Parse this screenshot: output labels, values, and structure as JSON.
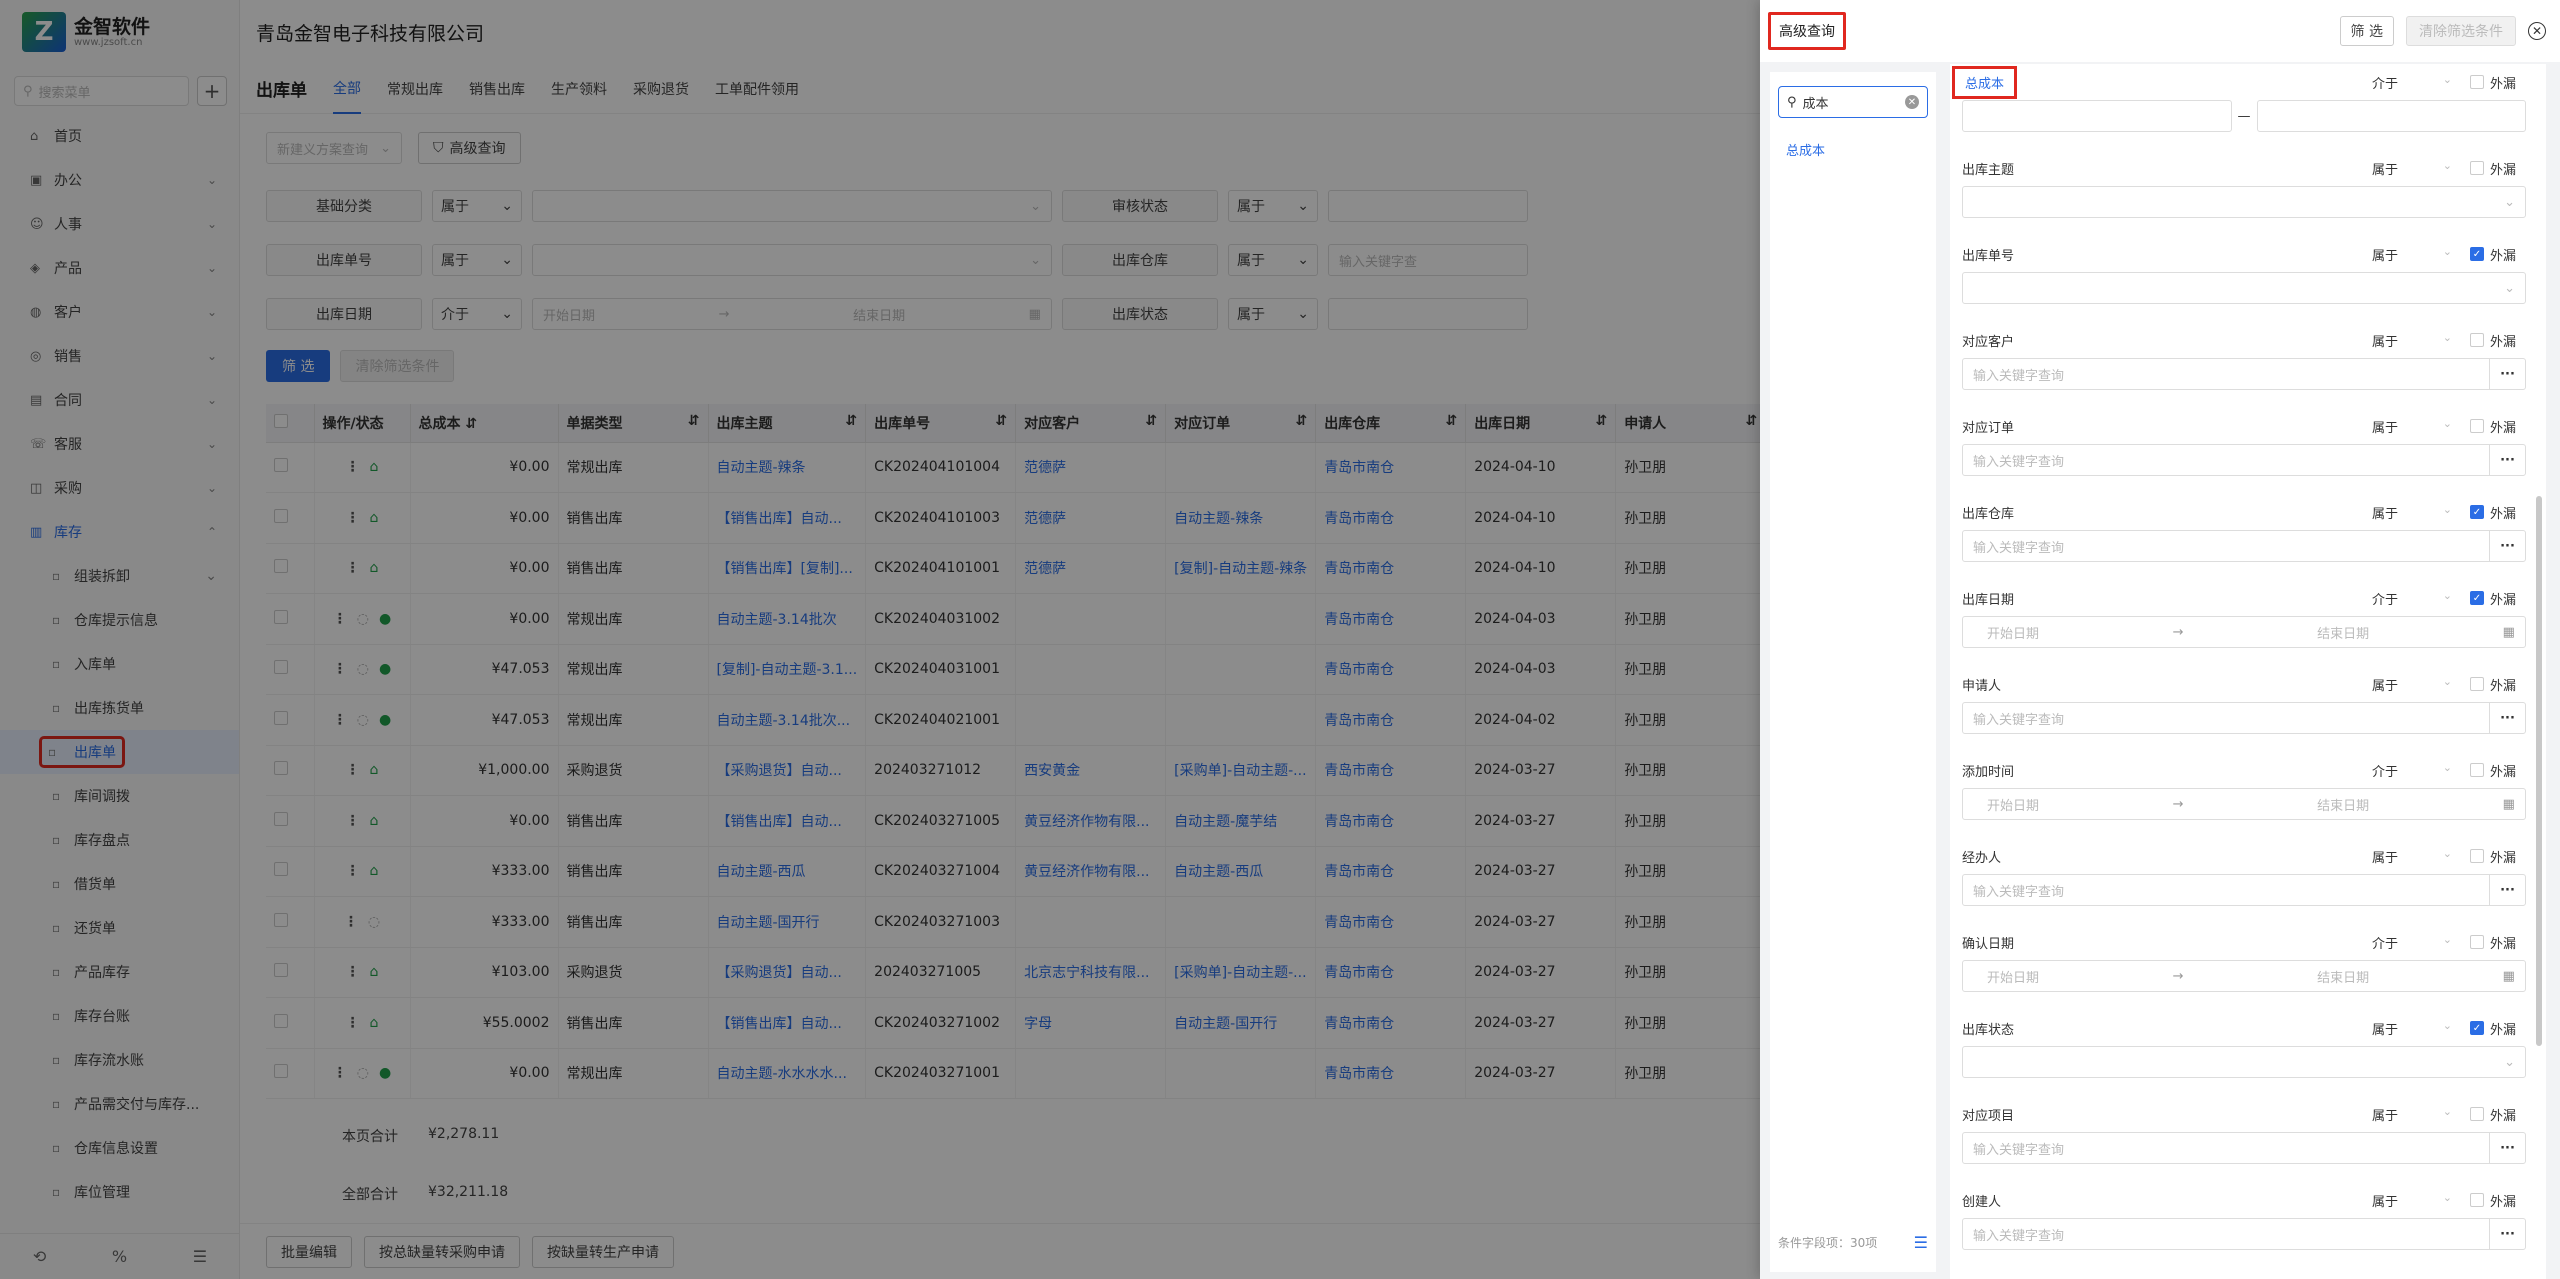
{
  "brand": {
    "name": "金智软件",
    "url": "www.jzsoft.cn"
  },
  "company": "青岛金智电子科技有限公司",
  "sidebar": {
    "search_placeholder": "搜索菜单",
    "items": [
      {
        "icon": "home-icon",
        "label": "首页"
      },
      {
        "icon": "office-icon",
        "label": "办公"
      },
      {
        "icon": "people-icon",
        "label": "人事"
      },
      {
        "icon": "product-icon",
        "label": "产品"
      },
      {
        "icon": "customer-icon",
        "label": "客户"
      },
      {
        "icon": "sales-icon",
        "label": "销售"
      },
      {
        "icon": "contract-icon",
        "label": "合同"
      },
      {
        "icon": "service-icon",
        "label": "客服"
      },
      {
        "icon": "purchase-icon",
        "label": "采购"
      },
      {
        "icon": "warehouse-icon",
        "label": "库存"
      }
    ],
    "sub_items": [
      "组装拆卸",
      "仓库提示信息",
      "入库单",
      "出库拣货单",
      "出库单",
      "库间调拨",
      "库存盘点",
      "借货单",
      "还货单",
      "产品库存",
      "库存台账",
      "库存流水账",
      "产品需交付与库存...",
      "仓库信息设置",
      "库位管理"
    ]
  },
  "page": {
    "title": "出库单",
    "tabs": [
      "全部",
      "常规出库",
      "销售出库",
      "生产领料",
      "采购退货",
      "工单配件领用"
    ],
    "custom_query_placeholder": "新建义方案查询",
    "advanced_query": "高级查询",
    "filters": [
      {
        "label": "基础分类",
        "op": "属于",
        "val": ""
      },
      {
        "label": "审核状态",
        "op": "属于",
        "val": ""
      },
      {
        "label": "出库单号",
        "op": "属于",
        "val": ""
      },
      {
        "label": "出库仓库",
        "op": "属于",
        "val": "输入关键字查"
      },
      {
        "label": "出库日期",
        "op": "介于",
        "start": "开始日期",
        "end": "结束日期"
      },
      {
        "label": "出库状态",
        "op": "属于",
        "val": ""
      }
    ],
    "filter_btn": "筛 选",
    "clear_btn": "清除筛选条件"
  },
  "table": {
    "headers": [
      "操作/状态",
      "总成本",
      "单据类型",
      "出库主题",
      "出库单号",
      "对应客户",
      "对应订单",
      "出库仓库",
      "出库日期",
      "申请人"
    ],
    "rows": [
      {
        "icons": "g",
        "cost": "¥0.00",
        "type": "常规出库",
        "subject": "自动主题-辣条",
        "no": "CK202404101004",
        "customer": "范德萨",
        "order": "",
        "wh": "青岛市南仓",
        "date": "2024-04-10",
        "applicant": "孙卫朋"
      },
      {
        "icons": "g",
        "cost": "¥0.00",
        "type": "销售出库",
        "subject": "【销售出库】自动...",
        "no": "CK202404101003",
        "customer": "范德萨",
        "order": "自动主题-辣条",
        "wh": "青岛市南仓",
        "date": "2024-04-10",
        "applicant": "孙卫朋"
      },
      {
        "icons": "g",
        "cost": "¥0.00",
        "type": "销售出库",
        "subject": "【销售出库】[复制]...",
        "no": "CK202404101001",
        "customer": "范德萨",
        "order": "[复制]-自动主题-辣条",
        "wh": "青岛市南仓",
        "date": "2024-04-10",
        "applicant": "孙卫朋"
      },
      {
        "icons": "rg",
        "cost": "¥0.00",
        "type": "常规出库",
        "subject": "自动主题-3.14批次",
        "no": "CK202404031002",
        "customer": "",
        "order": "",
        "wh": "青岛市南仓",
        "date": "2024-04-03",
        "applicant": "孙卫朋"
      },
      {
        "icons": "rg",
        "cost": "¥47.053",
        "type": "常规出库",
        "subject": "[复制]-自动主题-3.1...",
        "no": "CK202404031001",
        "customer": "",
        "order": "",
        "wh": "青岛市南仓",
        "date": "2024-04-03",
        "applicant": "孙卫朋"
      },
      {
        "icons": "rg",
        "cost": "¥47.053",
        "type": "常规出库",
        "subject": "自动主题-3.14批次...",
        "no": "CK202404021001",
        "customer": "",
        "order": "",
        "wh": "青岛市南仓",
        "date": "2024-04-02",
        "applicant": "孙卫朋"
      },
      {
        "icons": "g",
        "cost": "¥1,000.00",
        "type": "采购退货",
        "subject": "【采购退货】自动...",
        "no": "202403271012",
        "customer": "西安黄金",
        "order": "[采购单]-自动主题-...",
        "wh": "青岛市南仓",
        "date": "2024-03-27",
        "applicant": "孙卫朋"
      },
      {
        "icons": "g",
        "cost": "¥0.00",
        "type": "销售出库",
        "subject": "【销售出库】自动...",
        "no": "CK202403271005",
        "customer": "黄豆经济作物有限...",
        "order": "自动主题-魔芋结",
        "wh": "青岛市南仓",
        "date": "2024-03-27",
        "applicant": "孙卫朋"
      },
      {
        "icons": "g",
        "cost": "¥333.00",
        "type": "销售出库",
        "subject": "自动主题-西瓜",
        "no": "CK202403271004",
        "customer": "黄豆经济作物有限...",
        "order": "自动主题-西瓜",
        "wh": "青岛市南仓",
        "date": "2024-03-27",
        "applicant": "孙卫朋"
      },
      {
        "icons": "r",
        "cost": "¥333.00",
        "type": "销售出库",
        "subject": "自动主题-国开行",
        "no": "CK202403271003",
        "customer": "",
        "order": "",
        "wh": "青岛市南仓",
        "date": "2024-03-27",
        "applicant": "孙卫朋"
      },
      {
        "icons": "g",
        "cost": "¥103.00",
        "type": "采购退货",
        "subject": "【采购退货】自动...",
        "no": "202403271005",
        "customer": "北京志宁科技有限...",
        "order": "[采购单]-自动主题-...",
        "wh": "青岛市南仓",
        "date": "2024-03-27",
        "applicant": "孙卫朋"
      },
      {
        "icons": "g",
        "cost": "¥55.0002",
        "type": "销售出库",
        "subject": "【销售出库】自动...",
        "no": "CK202403271002",
        "customer": "字母",
        "order": "自动主题-国开行",
        "wh": "青岛市南仓",
        "date": "2024-03-27",
        "applicant": "孙卫朋"
      },
      {
        "icons": "rg",
        "cost": "¥0.00",
        "type": "常规出库",
        "subject": "自动主题-水水水水...",
        "no": "CK202403271001",
        "customer": "",
        "order": "",
        "wh": "青岛市南仓",
        "date": "2024-03-27",
        "applicant": "孙卫朋"
      }
    ],
    "page_total_label": "本页合计",
    "page_total": "¥2,278.11",
    "all_total_label": "全部合计",
    "all_total": "¥32,211.18"
  },
  "bottom_buttons": [
    "批量编辑",
    "按总缺量转采购申请",
    "按缺量转生产申请"
  ],
  "drawer": {
    "title": "高级查询",
    "filter_btn": "筛 选",
    "clear_btn": "清除筛选条件",
    "search_value": "成本",
    "result": "总成本",
    "field_count": "条件字段项：30项",
    "outer_label": "外漏",
    "fields": [
      {
        "name": "总成本",
        "op": "介于",
        "checked": false,
        "kind": "range"
      },
      {
        "name": "出库主题",
        "op": "属于",
        "checked": false,
        "kind": "select"
      },
      {
        "name": "出库单号",
        "op": "属于",
        "checked": true,
        "kind": "select"
      },
      {
        "name": "对应客户",
        "op": "属于",
        "checked": false,
        "kind": "more",
        "ph": "输入关键字查询"
      },
      {
        "name": "对应订单",
        "op": "属于",
        "checked": false,
        "kind": "more",
        "ph": "输入关键字查询"
      },
      {
        "name": "出库仓库",
        "op": "属于",
        "checked": true,
        "kind": "more",
        "ph": "输入关键字查询"
      },
      {
        "name": "出库日期",
        "op": "介于",
        "checked": true,
        "kind": "date",
        "start": "开始日期",
        "end": "结束日期"
      },
      {
        "name": "申请人",
        "op": "属于",
        "checked": false,
        "kind": "more",
        "ph": "输入关键字查询"
      },
      {
        "name": "添加时间",
        "op": "介于",
        "checked": false,
        "kind": "date",
        "start": "开始日期",
        "end": "结束日期"
      },
      {
        "name": "经办人",
        "op": "属于",
        "checked": false,
        "kind": "more",
        "ph": "输入关键字查询"
      },
      {
        "name": "确认日期",
        "op": "介于",
        "checked": false,
        "kind": "date",
        "start": "开始日期",
        "end": "结束日期"
      },
      {
        "name": "出库状态",
        "op": "属于",
        "checked": true,
        "kind": "select"
      },
      {
        "name": "对应项目",
        "op": "属于",
        "checked": false,
        "kind": "more",
        "ph": "输入关键字查询"
      },
      {
        "name": "创建人",
        "op": "属于",
        "checked": false,
        "kind": "more",
        "ph": "输入关键字查询"
      }
    ]
  },
  "colors": {
    "primary": "#2b6de5",
    "highlight": "#e0281f",
    "status_green": "#22a04b"
  }
}
